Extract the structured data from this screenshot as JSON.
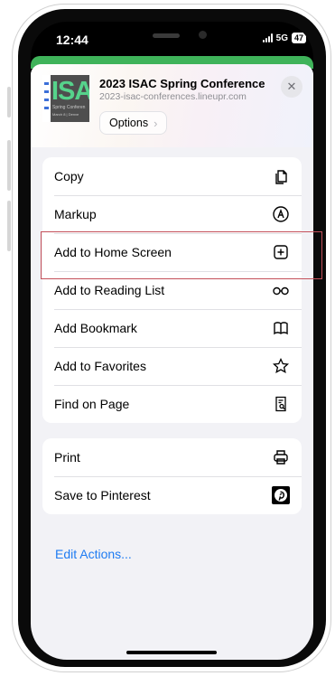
{
  "status_bar": {
    "time": "12:44",
    "network": "5G",
    "battery": "47"
  },
  "share_header": {
    "thumbnail_text": "ISA",
    "thumbnail_sub": "Spring Conferen",
    "thumbnail_sub2": "March 8 | Denve",
    "title": "2023 ISAC Spring Conference",
    "url": "2023-isac-conferences.lineupr.com",
    "options_label": "Options",
    "options_chevron": "›",
    "close_glyph": "✕"
  },
  "actions_group_1": [
    {
      "label": "Copy",
      "icon": "copy-icon"
    },
    {
      "label": "Markup",
      "icon": "markup-icon"
    },
    {
      "label": "Add to Home Screen",
      "icon": "add-square-icon"
    },
    {
      "label": "Add to Reading List",
      "icon": "glasses-icon"
    },
    {
      "label": "Add Bookmark",
      "icon": "book-icon"
    },
    {
      "label": "Add to Favorites",
      "icon": "star-icon"
    },
    {
      "label": "Find on Page",
      "icon": "find-document-icon"
    }
  ],
  "actions_group_2": [
    {
      "label": "Print",
      "icon": "printer-icon"
    },
    {
      "label": "Save to Pinterest",
      "icon": "pinterest-icon"
    }
  ],
  "edit_actions_label": "Edit Actions...",
  "colors": {
    "accent": "#1f7cf2",
    "green_bar": "#3fb35a",
    "highlight": "#c4505a"
  }
}
